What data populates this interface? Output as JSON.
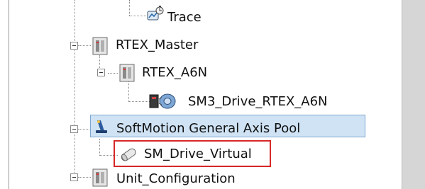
{
  "tree": {
    "nodes": [
      {
        "label": "Trace",
        "icon": "trace-icon"
      },
      {
        "label": "RTEX_Master",
        "icon": "device-module-icon"
      },
      {
        "label": "RTEX_A6N",
        "icon": "device-module-icon"
      },
      {
        "label": "SM3_Drive_RTEX_A6N",
        "icon": "servo-drive-icon"
      },
      {
        "label": "SoftMotion General Axis Pool",
        "icon": "axis-pool-icon",
        "selected": true
      },
      {
        "label": "SM_Drive_Virtual",
        "icon": "virtual-drive-icon",
        "highlighted": true
      },
      {
        "label": "Unit_Configuration",
        "icon": "device-module-icon"
      }
    ]
  },
  "colors": {
    "selection_bg": "#cfe3f5",
    "selection_border": "#7ea7cf",
    "highlight_border": "#d62828",
    "scrollbar": "#d6d6d6"
  }
}
